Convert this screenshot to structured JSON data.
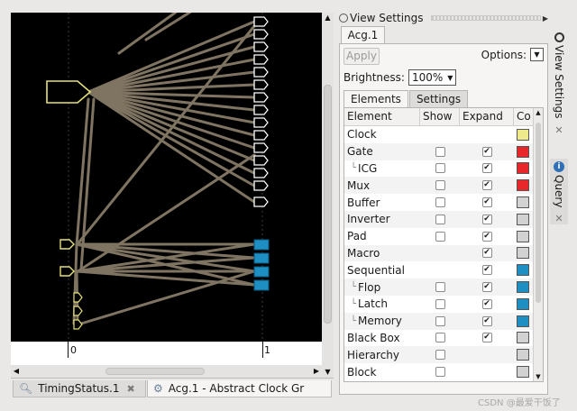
{
  "schematic": {
    "ruler_ticks": [
      "0",
      "1"
    ],
    "colors": {
      "wire": "#7f7461",
      "clock_outline": "#e6e07a",
      "flop": "#1e8fc2",
      "gate_outline": "#ffffff"
    }
  },
  "bottom_tabs": [
    {
      "label": "TimingStatus.1",
      "icon": "magnifier-icon",
      "active": false
    },
    {
      "label": "Acg.1 - Abstract Clock Gr",
      "icon": "clock-graph-icon",
      "active": true
    }
  ],
  "panel": {
    "title": "View Settings",
    "doc_tab": "Acg.1",
    "apply_label": "Apply",
    "options_label": "Options:",
    "brightness_label": "Brightness:",
    "brightness_value": "100%",
    "subtabs": [
      "Elements",
      "Settings"
    ],
    "columns": [
      "Element",
      "Show",
      "Expand",
      "Co"
    ],
    "rows": [
      {
        "name": "Clock",
        "indent": false,
        "show": null,
        "expand": null,
        "color": "#eee98a"
      },
      {
        "name": "Gate",
        "indent": false,
        "show": false,
        "expand": true,
        "color": "#e8272b"
      },
      {
        "name": "ICG",
        "indent": true,
        "show": false,
        "expand": true,
        "color": "#e8272b"
      },
      {
        "name": "Mux",
        "indent": false,
        "show": false,
        "expand": true,
        "color": "#e8272b"
      },
      {
        "name": "Buffer",
        "indent": false,
        "show": false,
        "expand": true,
        "color": "#d2d2d2"
      },
      {
        "name": "Inverter",
        "indent": false,
        "show": false,
        "expand": true,
        "color": "#d2d2d2"
      },
      {
        "name": "Pad",
        "indent": false,
        "show": false,
        "expand": true,
        "color": "#d2d2d2"
      },
      {
        "name": "Macro",
        "indent": false,
        "show": null,
        "expand": true,
        "color": "#d2d2d2"
      },
      {
        "name": "Sequential",
        "indent": false,
        "show": null,
        "expand": true,
        "color": "#1e8fc2"
      },
      {
        "name": "Flop",
        "indent": true,
        "show": false,
        "expand": true,
        "color": "#1e8fc2"
      },
      {
        "name": "Latch",
        "indent": true,
        "show": false,
        "expand": true,
        "color": "#1e8fc2"
      },
      {
        "name": "Memory",
        "indent": true,
        "show": false,
        "expand": true,
        "color": "#1e8fc2"
      },
      {
        "name": "Black Box",
        "indent": false,
        "show": false,
        "expand": true,
        "color": "#d2d2d2"
      },
      {
        "name": "Hierarchy",
        "indent": false,
        "show": false,
        "expand": null,
        "color": "#d2d2d2"
      },
      {
        "name": "Block",
        "indent": false,
        "show": false,
        "expand": null,
        "color": "#d2d2d2"
      }
    ]
  },
  "side_tabs": [
    {
      "label": "View Settings",
      "icon": "lock-icon"
    },
    {
      "label": "Query",
      "icon": "info-icon"
    }
  ],
  "watermark": "CSDN @最爱干饭了"
}
